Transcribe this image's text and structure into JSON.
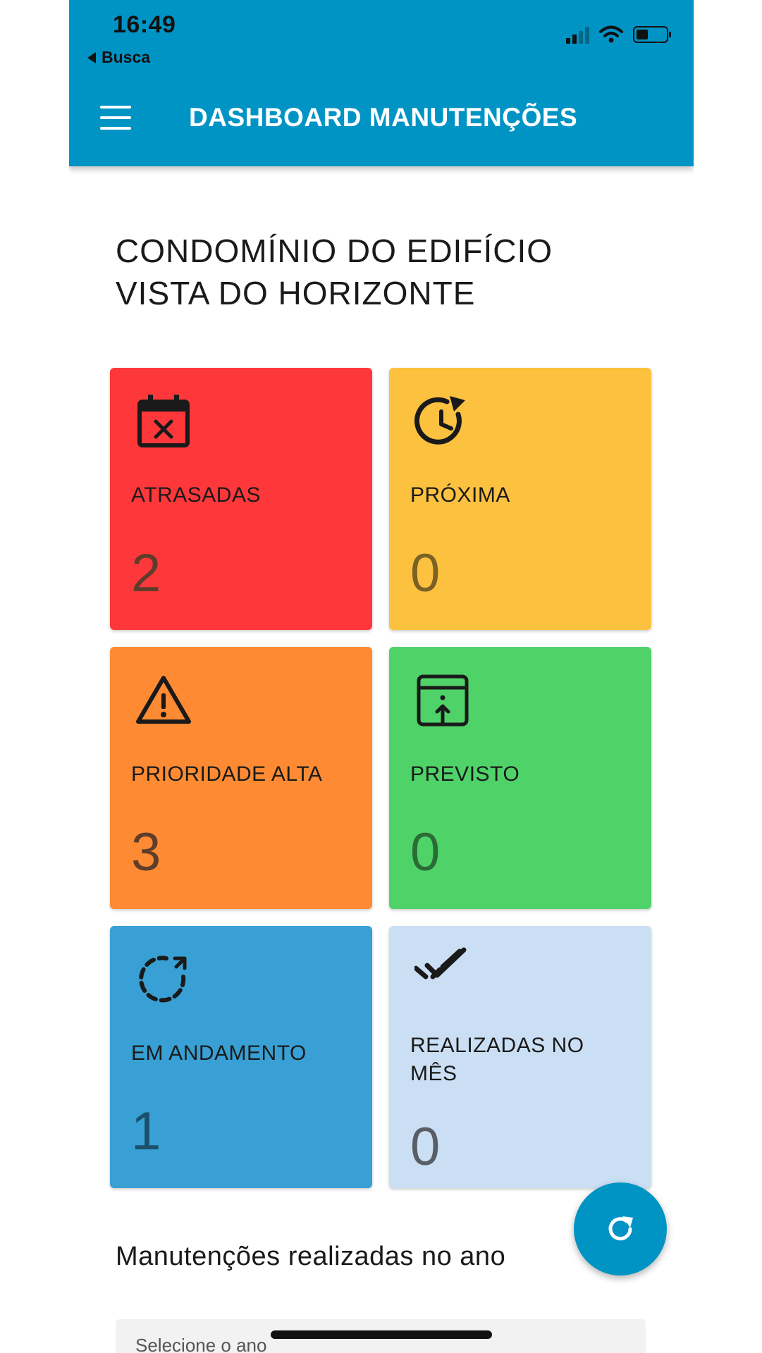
{
  "status_bar": {
    "time": "16:49",
    "back_label": "Busca"
  },
  "app_bar": {
    "title": "DASHBOARD MANUTENÇÕES"
  },
  "condo": {
    "line1": "CONDOMÍNIO DO EDIFÍCIO",
    "line2": "VISTA DO HORIZONTE"
  },
  "cards": {
    "atrasadas": {
      "label": "ATRASADAS",
      "value": "2",
      "color": "#fe383a",
      "icon": "calendar-x-icon"
    },
    "proxima": {
      "label": "PRÓXIMA",
      "value": "0",
      "color": "#fdc140",
      "icon": "clock-refresh-icon"
    },
    "prioridade": {
      "label": "PRIORIDADE ALTA",
      "value": "3",
      "color": "#fe8b33",
      "icon": "warning-icon"
    },
    "previsto": {
      "label": "PREVISTO",
      "value": "0",
      "color": "#4fd369",
      "icon": "calendar-upload-icon"
    },
    "andamento": {
      "label": "EM ANDAMENTO",
      "value": "1",
      "color": "#38a0d4",
      "icon": "dashed-circle-arrow-icon"
    },
    "realizadas": {
      "label_line1": "REALIZADAS NO",
      "label_line2": "MÊS",
      "value": "0",
      "color": "#cbdff4",
      "icon": "double-check-icon"
    }
  },
  "fab": {
    "icon": "refresh-icon",
    "color": "#0094c5"
  },
  "section": {
    "title": "Manutenções realizadas no ano"
  },
  "year_select": {
    "placeholder": "Selecione o ano"
  }
}
